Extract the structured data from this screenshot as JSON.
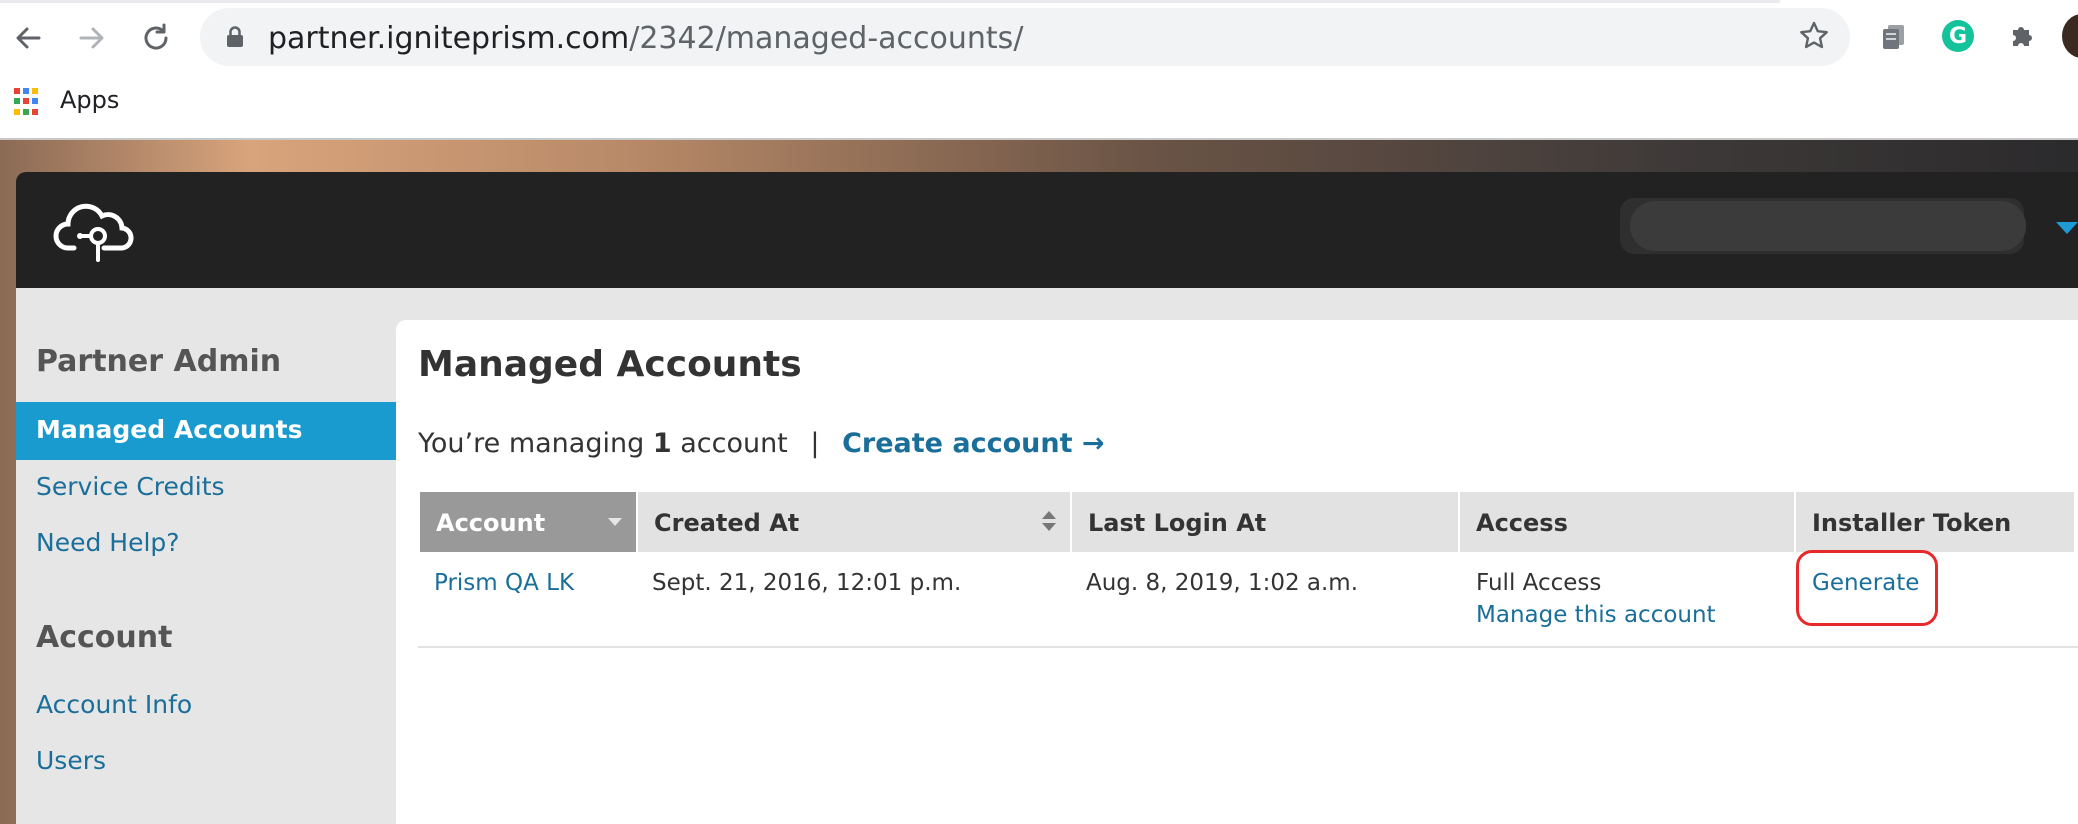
{
  "browser": {
    "url_host": "partner.igniteprism.com",
    "url_path": "/2342/managed-accounts/",
    "bookmark_apps": "Apps",
    "grammarly_letter": "G",
    "apps_colors": [
      "#ea4335",
      "#4285f4",
      "#fbbc05",
      "#34a853",
      "#ea4335",
      "#4285f4",
      "#fbbc05",
      "#34a853",
      "#ea4335"
    ]
  },
  "sidebar": {
    "partner_heading": "Partner Admin",
    "partner_items": [
      {
        "label": "Managed Accounts",
        "active": true
      },
      {
        "label": "Service Credits",
        "active": false
      },
      {
        "label": "Need Help?",
        "active": false
      }
    ],
    "account_heading": "Account",
    "account_items": [
      {
        "label": "Account Info"
      },
      {
        "label": "Users"
      }
    ]
  },
  "main": {
    "title": "Managed Accounts",
    "summary_prefix": "You’re managing",
    "summary_count": "1",
    "summary_suffix": "account",
    "summary_sep": "|",
    "create_link": "Create account →"
  },
  "table": {
    "headers": [
      "Account",
      "Created At",
      "Last Login At",
      "Access",
      "Installer Token"
    ],
    "rows": [
      {
        "account": "Prism QA LK",
        "created_at": "Sept. 21, 2016, 12:01 p.m.",
        "last_login": "Aug. 8, 2019, 1:02 a.m.",
        "access": "Full Access",
        "manage_link": "Manage this account",
        "token_action": "Generate"
      }
    ]
  },
  "colors": {
    "accent": "#1a9bd0",
    "link": "#1a6f9a",
    "header_dark": "#222222",
    "highlight": "#e8292b"
  }
}
